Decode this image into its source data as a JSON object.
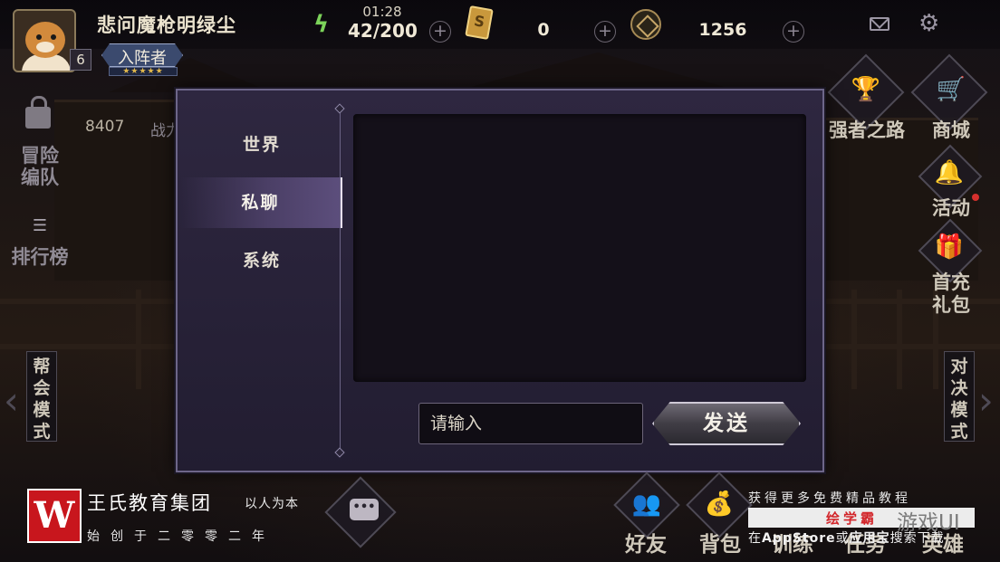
{
  "player": {
    "name": "悲问魔枪明绿尘",
    "level": "6",
    "rank_title": "入阵者",
    "rank_stars": "★★★★★"
  },
  "resources": {
    "timer": "01:28",
    "stamina": "42/200",
    "card_count": "0",
    "coins": "1256"
  },
  "left_menu": {
    "team_label_1": "冒险",
    "team_label_2": "编队",
    "power_value": "8407",
    "power_label": "战力",
    "ranking_label": "排行榜",
    "guild_mode_label": "帮会模式"
  },
  "right_menu": {
    "strong_road": "强者之路",
    "shop": "商城",
    "activity": "活动",
    "first_recharge_1": "首充",
    "first_recharge_2": "礼包",
    "duel_mode_label": "对决模式"
  },
  "chat_dialog": {
    "tabs": [
      {
        "label": "世界"
      },
      {
        "label": "私聊"
      },
      {
        "label": "系统"
      }
    ],
    "active_tab": "私聊",
    "input_placeholder": "请输入",
    "send_label": "发送"
  },
  "bottom_bar": {
    "friends": "好友",
    "bag": "背包",
    "train": "训练",
    "task": "任务",
    "hero": "英雄"
  },
  "watermark_left": {
    "title": "王氏教育集团",
    "slogan": "以人为本",
    "subtitle": "始创于二零零二年"
  },
  "watermark_right": {
    "line1": "获得更多免费精品教程",
    "brand": "绘学霸",
    "logo_text": "游戏UI",
    "line3_a": "在",
    "line3_b": "AppStore",
    "line3_c": "或",
    "line3_d": "应用宝",
    "line3_e": "搜索下载"
  },
  "colors": {
    "accent": "#5c4e7c",
    "dialog_bg": "#2e2740",
    "gold": "#c7a14a"
  }
}
